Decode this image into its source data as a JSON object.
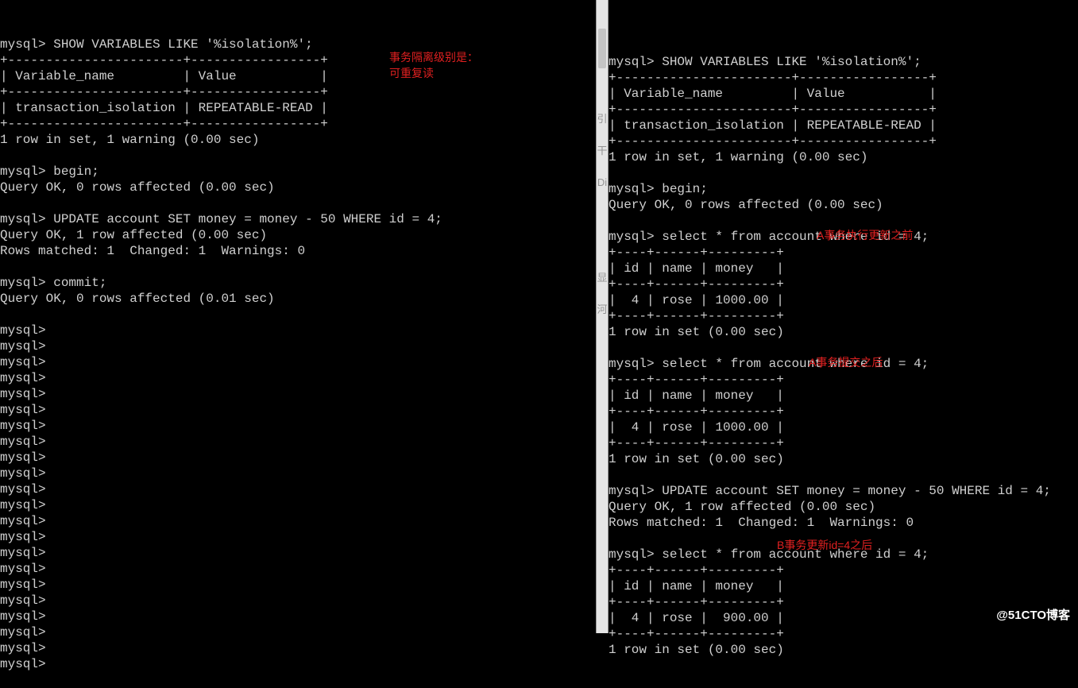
{
  "left": {
    "lines": [
      "mysql> SHOW VARIABLES LIKE '%isolation%';",
      "+-----------------------+-----------------+",
      "| Variable_name         | Value           |",
      "+-----------------------+-----------------+",
      "| transaction_isolation | REPEATABLE-READ |",
      "+-----------------------+-----------------+",
      "1 row in set, 1 warning (0.00 sec)",
      "",
      "mysql> begin;",
      "Query OK, 0 rows affected (0.00 sec)",
      "",
      "mysql> UPDATE account SET money = money - 50 WHERE id = 4;",
      "Query OK, 1 row affected (0.00 sec)",
      "Rows matched: 1  Changed: 1  Warnings: 0",
      "",
      "mysql> commit;",
      "Query OK, 0 rows affected (0.01 sec)",
      "",
      "mysql>",
      "mysql>",
      "mysql>",
      "mysql>",
      "mysql>",
      "mysql>",
      "mysql>",
      "mysql>",
      "mysql>",
      "mysql>",
      "mysql>",
      "mysql>",
      "mysql>",
      "mysql>",
      "mysql>",
      "mysql>",
      "mysql>",
      "mysql>",
      "mysql>",
      "mysql>",
      "mysql>",
      "mysql>"
    ]
  },
  "right": {
    "lines": [
      "mysql> SHOW VARIABLES LIKE '%isolation%';",
      "+-----------------------+-----------------+",
      "| Variable_name         | Value           |",
      "+-----------------------+-----------------+",
      "| transaction_isolation | REPEATABLE-READ |",
      "+-----------------------+-----------------+",
      "1 row in set, 1 warning (0.00 sec)",
      "",
      "mysql> begin;",
      "Query OK, 0 rows affected (0.00 sec)",
      "",
      "mysql> select * from account where id = 4;",
      "+----+------+---------+",
      "| id | name | money   |",
      "+----+------+---------+",
      "|  4 | rose | 1000.00 |",
      "+----+------+---------+",
      "1 row in set (0.00 sec)",
      "",
      "mysql> select * from account where id = 4;",
      "+----+------+---------+",
      "| id | name | money   |",
      "+----+------+---------+",
      "|  4 | rose | 1000.00 |",
      "+----+------+---------+",
      "1 row in set (0.00 sec)",
      "",
      "mysql> UPDATE account SET money = money - 50 WHERE id = 4;",
      "Query OK, 1 row affected (0.00 sec)",
      "Rows matched: 1  Changed: 1  Warnings: 0",
      "",
      "mysql> select * from account where id = 4;",
      "+----+------+---------+",
      "| id | name | money   |",
      "+----+------+---------+",
      "|  4 | rose |  900.00 |",
      "+----+------+---------+",
      "1 row in set (0.00 sec)"
    ]
  },
  "annotations": {
    "left1": "事务隔离级别是：\n可重复读",
    "right1": "A事务执行更新之前",
    "right2": "A事务提交之后",
    "right3": "B事务更新id=4之后"
  },
  "watermark": "@51CTO博客"
}
